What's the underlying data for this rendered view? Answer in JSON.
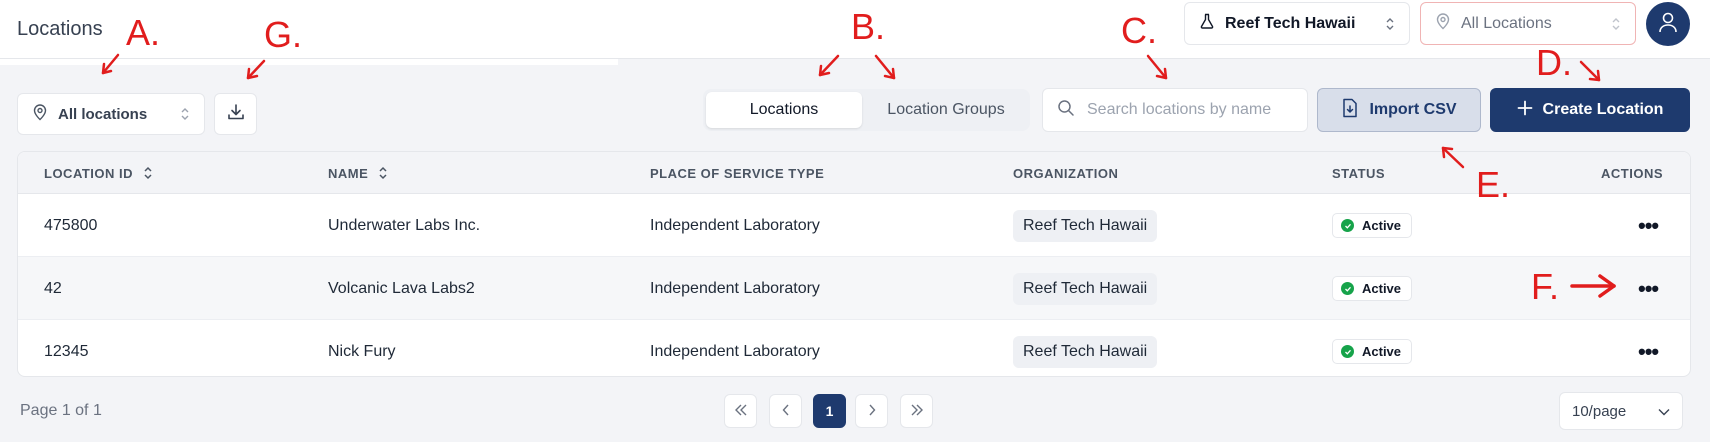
{
  "header": {
    "page_title": "Locations",
    "org_select": "Reef Tech Hawaii",
    "location_select": "All Locations"
  },
  "toolbar": {
    "location_filter": "All locations",
    "tabs": [
      {
        "label": "Locations",
        "active": true
      },
      {
        "label": "Location Groups",
        "active": false
      }
    ],
    "search_placeholder": "Search locations by name",
    "import_label": "Import CSV",
    "create_label": "Create Location"
  },
  "table": {
    "columns": [
      "LOCATION ID",
      "NAME",
      "PLACE OF SERVICE TYPE",
      "ORGANIZATION",
      "STATUS",
      "ACTIONS"
    ],
    "rows": [
      {
        "id": "475800",
        "name": "Underwater Labs Inc.",
        "type": "Independent Laboratory",
        "org": "Reef Tech Hawaii",
        "status": "Active"
      },
      {
        "id": "42",
        "name": "Volcanic Lava Labs2",
        "type": "Independent Laboratory",
        "org": "Reef Tech Hawaii",
        "status": "Active"
      },
      {
        "id": "12345",
        "name": "Nick Fury",
        "type": "Independent Laboratory",
        "org": "Reef Tech Hawaii",
        "status": "Active"
      }
    ]
  },
  "pagination": {
    "info": "Page 1 of 1",
    "current_page": "1",
    "per_page": "10/page"
  },
  "annotations": {
    "a": "A.",
    "b": "B.",
    "c": "C.",
    "d": "D.",
    "e": "E.",
    "f": "F.",
    "g": "G."
  },
  "colors": {
    "primary": "#1e3a6e",
    "annotation": "#e11d1d",
    "status_active": "#16a34a"
  }
}
